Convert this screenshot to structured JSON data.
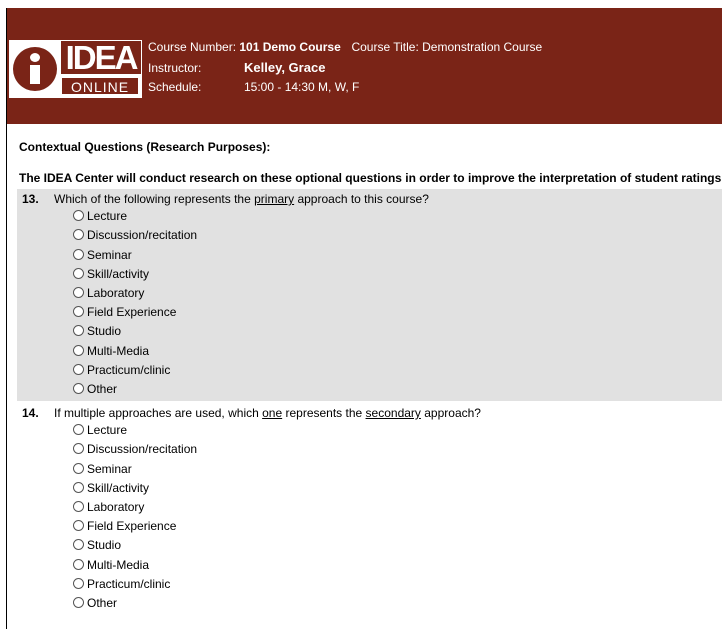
{
  "header": {
    "logo": {
      "word": "IDEA",
      "sub": "ONLINE"
    },
    "course_number_label": "Course Number:",
    "course_number": "101 Demo Course",
    "course_title_label": "Course Title:",
    "course_title": "Demonstration Course",
    "instructor_label": "Instructor:",
    "instructor": "Kelley, Grace",
    "schedule_label": "Schedule:",
    "schedule": "15:00 - 14:30 M, W, F"
  },
  "section_title": "Contextual Questions (Research Purposes):",
  "intro": "The IDEA Center will conduct research on these optional questions in order to improve the interpretation of student ratings.",
  "questions": [
    {
      "number": "13.",
      "text_parts": [
        "Which of the following represents the ",
        "primary",
        " approach to this course?"
      ],
      "options": [
        "Lecture",
        "Discussion/recitation",
        "Seminar",
        "Skill/activity",
        "Laboratory",
        "Field Experience",
        "Studio",
        "Multi-Media",
        "Practicum/clinic",
        "Other"
      ]
    },
    {
      "number": "14.",
      "text_parts": [
        "If multiple approaches are used, which ",
        "one",
        " represents the ",
        "secondary",
        " approach?"
      ],
      "options": [
        "Lecture",
        "Discussion/recitation",
        "Seminar",
        "Skill/activity",
        "Laboratory",
        "Field Experience",
        "Studio",
        "Multi-Media",
        "Practicum/clinic",
        "Other"
      ]
    }
  ],
  "colors": {
    "header_bg": "#7a2417",
    "question_shade": "#e1e1e1"
  }
}
